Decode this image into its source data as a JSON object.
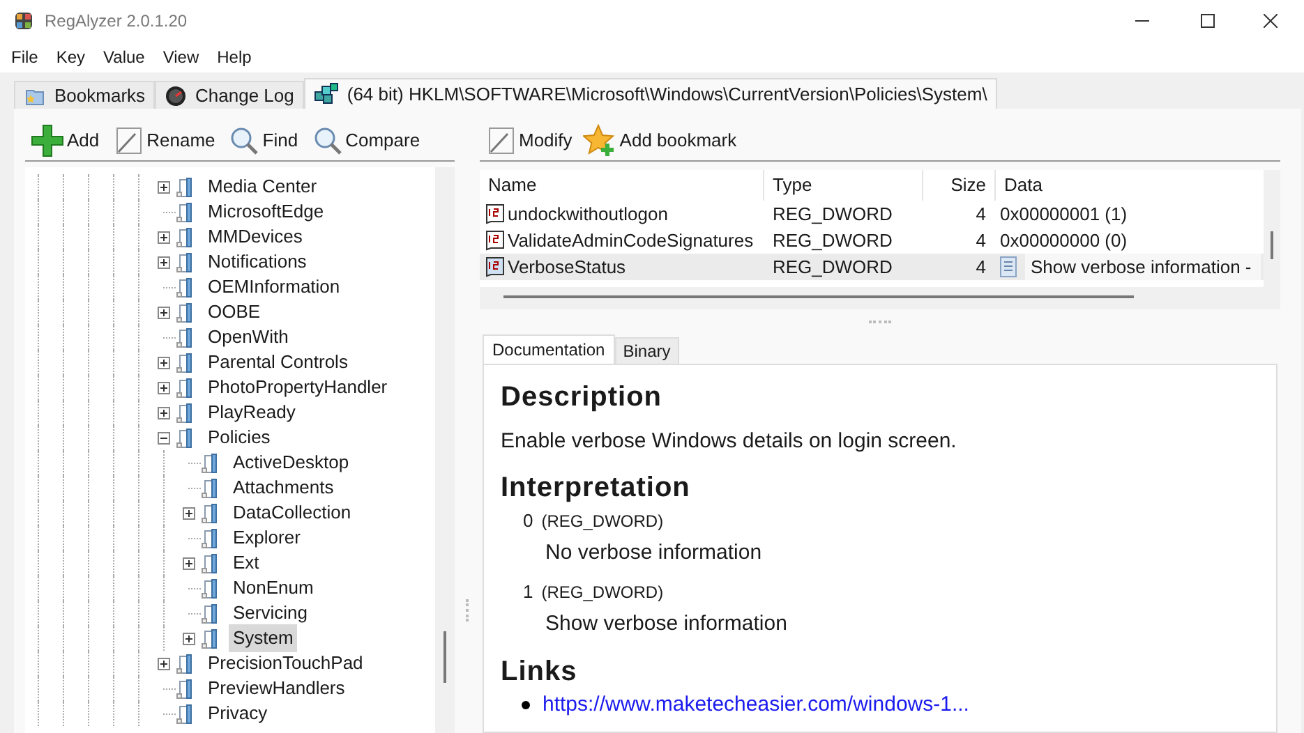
{
  "window": {
    "title": "RegAlyzer 2.0.1.20"
  },
  "menu": [
    "File",
    "Key",
    "Value",
    "View",
    "Help"
  ],
  "tabs": [
    {
      "label": "Bookmarks",
      "selected": false,
      "kind": "bookmarks"
    },
    {
      "label": "Change Log",
      "selected": false,
      "kind": "log"
    },
    {
      "label": "(64 bit) HKLM\\SOFTWARE\\Microsoft\\Windows\\CurrentVersion\\Policies\\System\\",
      "selected": true,
      "kind": "key"
    }
  ],
  "key_toolbar": [
    {
      "label": "Add",
      "kind": "add"
    },
    {
      "label": "Rename",
      "kind": "edit"
    },
    {
      "label": "Find",
      "kind": "search"
    },
    {
      "label": "Compare",
      "kind": "search"
    }
  ],
  "tree": [
    {
      "label": "Media Center",
      "kind": "branch",
      "expanded": false,
      "selected": false
    },
    {
      "label": "MicrosoftEdge",
      "kind": "leaf",
      "selected": false
    },
    {
      "label": "MMDevices",
      "kind": "branch",
      "expanded": false,
      "selected": false
    },
    {
      "label": "Notifications",
      "kind": "branch",
      "expanded": false,
      "selected": false
    },
    {
      "label": "OEMInformation",
      "kind": "leaf",
      "selected": false
    },
    {
      "label": "OOBE",
      "kind": "branch",
      "expanded": false,
      "selected": false
    },
    {
      "label": "OpenWith",
      "kind": "leaf",
      "selected": false
    },
    {
      "label": "Parental Controls",
      "kind": "branch",
      "expanded": false,
      "selected": false
    },
    {
      "label": "PhotoPropertyHandler",
      "kind": "branch",
      "expanded": false,
      "selected": false
    },
    {
      "label": "PlayReady",
      "kind": "branch",
      "expanded": false,
      "selected": false
    },
    {
      "label": "Policies",
      "kind": "branch",
      "expanded": true,
      "selected": false,
      "children": [
        {
          "label": "ActiveDesktop",
          "kind": "leaf",
          "selected": false
        },
        {
          "label": "Attachments",
          "kind": "leaf",
          "selected": false
        },
        {
          "label": "DataCollection",
          "kind": "branch",
          "expanded": false,
          "selected": false
        },
        {
          "label": "Explorer",
          "kind": "leaf",
          "selected": false
        },
        {
          "label": "Ext",
          "kind": "branch",
          "expanded": false,
          "selected": false
        },
        {
          "label": "NonEnum",
          "kind": "leaf",
          "selected": false
        },
        {
          "label": "Servicing",
          "kind": "leaf",
          "selected": false
        },
        {
          "label": "System",
          "kind": "branch",
          "expanded": false,
          "selected": true
        }
      ]
    },
    {
      "label": "PrecisionTouchPad",
      "kind": "branch",
      "expanded": false,
      "selected": false
    },
    {
      "label": "PreviewHandlers",
      "kind": "leaf",
      "selected": false
    },
    {
      "label": "Privacy",
      "kind": "leaf",
      "selected": false
    }
  ],
  "value_toolbar": [
    {
      "label": "Modify",
      "kind": "edit"
    },
    {
      "label": "Add bookmark",
      "kind": "bookmark"
    }
  ],
  "values": {
    "columns": [
      "Name",
      "Type",
      "Size",
      "Data"
    ],
    "rows": [
      {
        "name": "undockwithoutlogon",
        "type": "REG_DWORD",
        "size": "4",
        "data": "0x00000001 (1)",
        "documented": false,
        "selected": false
      },
      {
        "name": "ValidateAdminCodeSignatures",
        "type": "REG_DWORD",
        "size": "4",
        "data": "0x00000000 (0)",
        "documented": false,
        "selected": false
      },
      {
        "name": "VerboseStatus",
        "type": "REG_DWORD",
        "size": "4",
        "data": "Show verbose information -",
        "documented": true,
        "selected": true
      }
    ]
  },
  "doc_tabs": [
    {
      "label": "Documentation",
      "selected": true
    },
    {
      "label": "Binary",
      "selected": false
    }
  ],
  "documentation": {
    "description_heading": "Description",
    "description": "Enable verbose Windows details on login screen.",
    "interpretation_heading": "Interpretation",
    "interpretations": [
      {
        "value": "0",
        "type": "(REG_DWORD)",
        "meaning": "No verbose information"
      },
      {
        "value": "1",
        "type": "(REG_DWORD)",
        "meaning": "Show verbose information"
      }
    ],
    "links_heading": "Links",
    "links": [
      "https://www.maketecheasier.com/windows-1..."
    ]
  }
}
